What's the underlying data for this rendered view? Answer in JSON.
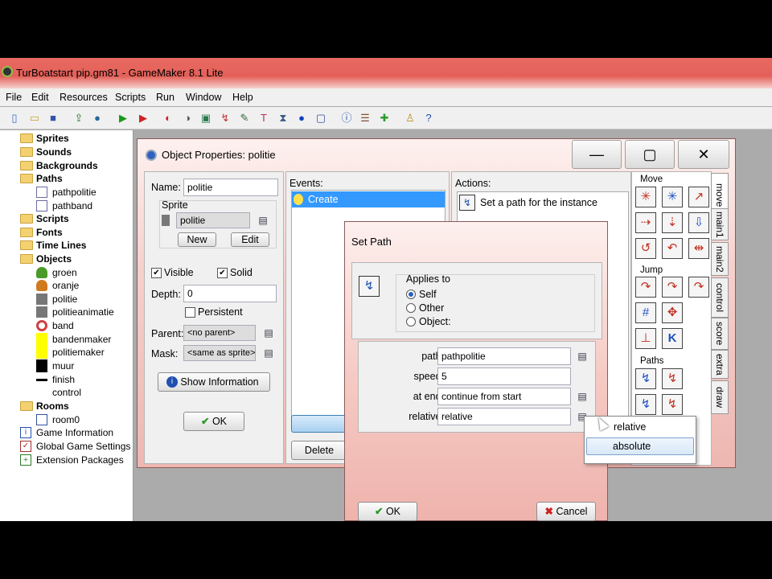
{
  "window_title": "TurBoatstart pip.gm81 - GameMaker 8.1 Lite",
  "menu": [
    "File",
    "Edit",
    "Resources",
    "Scripts",
    "Run",
    "Window",
    "Help"
  ],
  "tree": {
    "sprites": "Sprites",
    "sounds": "Sounds",
    "backgrounds": "Backgrounds",
    "paths": "Paths",
    "path_items": [
      "pathpolitie",
      "pathband"
    ],
    "scripts": "Scripts",
    "fonts": "Fonts",
    "timelines": "Time Lines",
    "objects": "Objects",
    "object_items": [
      "groen",
      "oranje",
      "politie",
      "politieanimatie",
      "band",
      "bandenmaker",
      "politiemaker",
      "muur",
      "finish",
      "control"
    ],
    "rooms": "Rooms",
    "room_items": [
      "room0"
    ],
    "game_info": "Game Information",
    "global_settings": "Global Game Settings",
    "extensions": "Extension Packages"
  },
  "objwin": {
    "title": "Object Properties: politie",
    "name_label": "Name:",
    "name_value": "politie",
    "sprite_label": "Sprite",
    "sprite_value": "politie",
    "new_btn": "New",
    "edit_btn": "Edit",
    "visible": "Visible",
    "solid": "Solid",
    "depth_label": "Depth:",
    "depth_value": "0",
    "persistent": "Persistent",
    "parent_label": "Parent:",
    "parent_value": "<no parent>",
    "mask_label": "Mask:",
    "mask_value": "<same as sprite>",
    "show_info": "Show Information",
    "ok": "OK",
    "events_label": "Events:",
    "event_create": "Create",
    "delete_btn": "Delete",
    "actions_label": "Actions:",
    "action_1": "Set a path for the instance",
    "group_move": "Move",
    "group_jump": "Jump",
    "group_paths": "Paths",
    "tabs": [
      "move",
      "main1",
      "main2",
      "control",
      "score",
      "extra",
      "draw"
    ]
  },
  "setpath": {
    "title": "Set Path",
    "applies_to": "Applies to",
    "self": "Self",
    "other": "Other",
    "object": "Object:",
    "path_label": "path:",
    "path_value": "pathpolitie",
    "speed_label": "speed:",
    "speed_value": "5",
    "atend_label": "at end:",
    "atend_value": "continue from start",
    "relative_label": "relative:",
    "relative_value": "relative",
    "ok": "OK",
    "cancel": "Cancel"
  },
  "popup": {
    "options": [
      "relative",
      "absolute"
    ],
    "selected": "absolute"
  }
}
